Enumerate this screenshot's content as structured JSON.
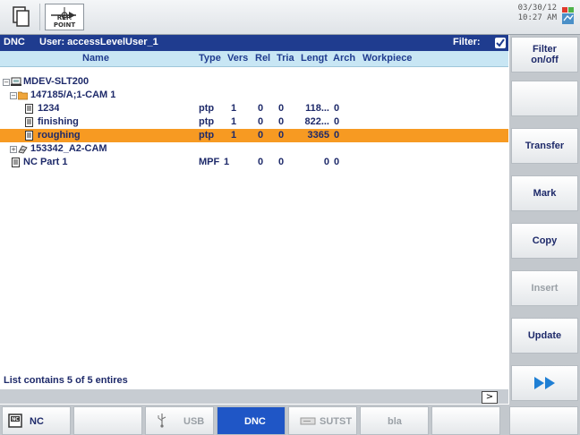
{
  "topbar": {
    "refpoint_label": "REF. POINT",
    "date": "03/30/12",
    "time": "10:27 AM"
  },
  "header": {
    "app": "DNC",
    "user": "User: accessLevelUser_1",
    "filter_label": "Filter:"
  },
  "columns": {
    "name": "Name",
    "type": "Type",
    "vers": "Vers",
    "rel": "Rel",
    "tria": "Tria",
    "length": "Lengt",
    "arch": "Arch",
    "workpiece": "Workpiece"
  },
  "tree": {
    "root": {
      "label": "MDEV-SLT200",
      "icon": "machine-icon"
    },
    "cam1": {
      "label": "147185/A;1-CAM 1",
      "icon": "folder-icon"
    },
    "files": [
      {
        "name": "1234",
        "type": "ptp",
        "vers": "1",
        "rel": "0",
        "tria": "0",
        "length": "118...",
        "arch": "0"
      },
      {
        "name": "finishing",
        "type": "ptp",
        "vers": "1",
        "rel": "0",
        "tria": "0",
        "length": "822...",
        "arch": "0"
      },
      {
        "name": "roughing",
        "type": "ptp",
        "vers": "1",
        "rel": "0",
        "tria": "0",
        "length": "3365",
        "arch": "0"
      }
    ],
    "cam2": {
      "label": "153342_A2-CAM",
      "icon": "cam-icon"
    },
    "ncpart": {
      "name": "NC Part 1",
      "type": "MPF",
      "vers": "1",
      "rel": "0",
      "tria": "0",
      "length": "0",
      "arch": "0"
    }
  },
  "status": {
    "list_count": "List contains 5 of 5 entires",
    "scroll_right": ">"
  },
  "softkeys_vertical": {
    "filter": "Filter on/off",
    "transfer": "Transfer",
    "mark": "Mark",
    "copy": "Copy",
    "insert": "Insert",
    "update": "Update"
  },
  "softkeys_horizontal": {
    "nc": "NC",
    "usb": "USB",
    "dnc": "DNC",
    "sutst": "SUTST",
    "bla": "bla"
  },
  "colors": {
    "header_blue": "#1f3c8f",
    "column_header_bg": "#c8e6f4",
    "selection_orange": "#f79a22",
    "active_tab": "#1f56c6"
  }
}
